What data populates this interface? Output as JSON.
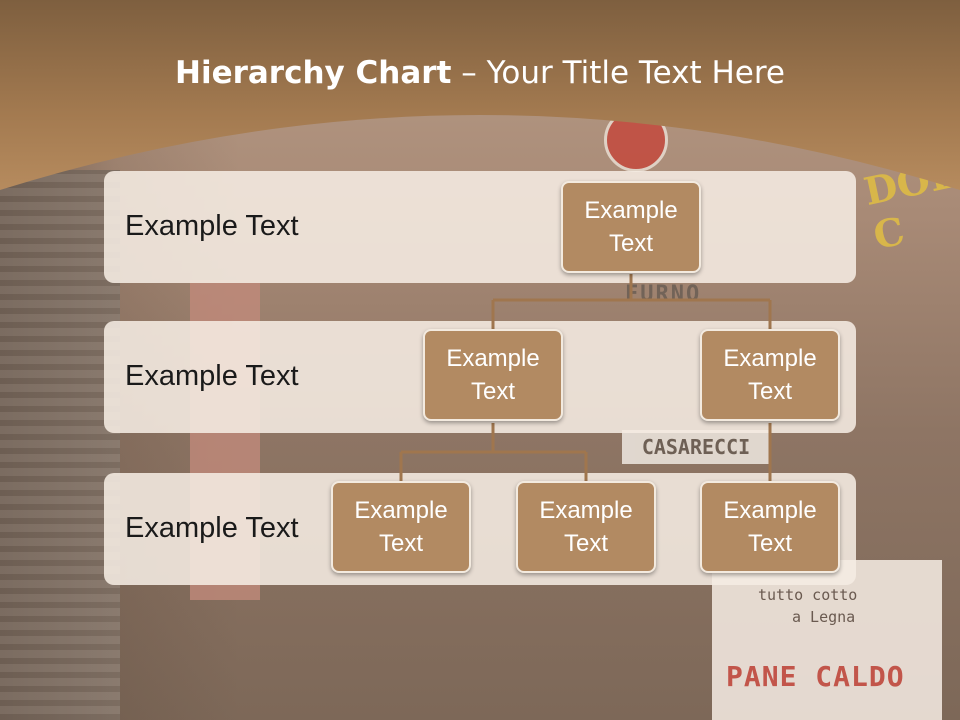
{
  "slide": {
    "title_bold": "Hierarchy Chart",
    "title_rest": " – Your Title Text Here",
    "colors": {
      "header_brown": "#a0784f",
      "band_fill": "#f5ece2",
      "node_fill": "#b28a62",
      "node_border": "#f3eadf",
      "connector": "#a0764e"
    }
  },
  "background_signs": {
    "dolci": "DOLCI C",
    "furno": "FURNO",
    "casarecci": "CASARECCI",
    "tutto": "tutto cotto",
    "legna": "a Legna",
    "pane": "PANE CALDO"
  },
  "levels": [
    {
      "label": "Example Text"
    },
    {
      "label": "Example Text"
    },
    {
      "label": "Example Text"
    }
  ],
  "nodes": {
    "root": {
      "line1": "Example",
      "line2": "Text"
    },
    "l2_left": {
      "line1": "Example",
      "line2": "Text"
    },
    "l2_right": {
      "line1": "Example",
      "line2": "Text"
    },
    "l3_a": {
      "line1": "Example",
      "line2": "Text"
    },
    "l3_b": {
      "line1": "Example",
      "line2": "Text"
    },
    "l3_c": {
      "line1": "Example",
      "line2": "Text"
    }
  }
}
